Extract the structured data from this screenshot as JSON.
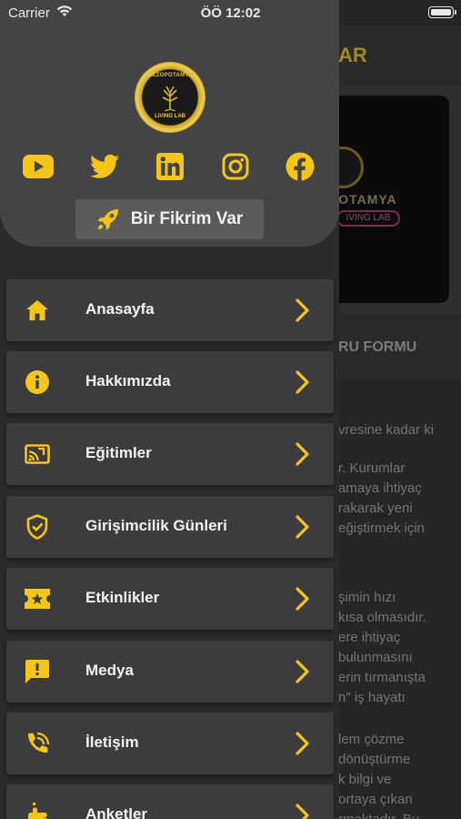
{
  "status_bar": {
    "carrier": "Carrier",
    "time": "ÖÖ 12:02"
  },
  "background_page": {
    "title_fragment": "AR",
    "banner_text": "OPOTAMYA",
    "banner_sub": "IVING LAB",
    "section_fragment": "RU FORMU",
    "paragraph1": [
      "vresine kadar ki"
    ],
    "paragraph2": [
      "r. Kurumlar",
      "amaya ihtiyaç",
      "rakarak yeni",
      "eğiştirmek için"
    ],
    "paragraph3": [
      "şimin hızı",
      "kısa olmasıdır.",
      "ere ihtiyaç",
      "bulunmasını",
      "erin tırmanışta",
      "n\" iş hayatı"
    ],
    "paragraph4": [
      "lem çözme",
      "dönüştürme",
      "k bilgi ve",
      "ortaya çıkan",
      "rmaktadır. Bu"
    ]
  },
  "drawer": {
    "logo": {
      "top_text": "MEZOPOTAMYA",
      "bottom_text": "LIVING LAB"
    },
    "socials": [
      {
        "name": "youtube",
        "icon": "youtube-icon"
      },
      {
        "name": "twitter",
        "icon": "twitter-icon"
      },
      {
        "name": "linkedin",
        "icon": "linkedin-icon"
      },
      {
        "name": "instagram",
        "icon": "instagram-icon"
      },
      {
        "name": "facebook",
        "icon": "facebook-icon"
      }
    ],
    "idea_button_label": "Bir Fikrim Var",
    "menu": [
      {
        "label": "Anasayfa",
        "icon": "home-icon"
      },
      {
        "label": "Hakkımızda",
        "icon": "info-icon"
      },
      {
        "label": "Eğitimler",
        "icon": "cast-education-icon"
      },
      {
        "label": "Girişimcilik Günleri",
        "icon": "shield-check-icon"
      },
      {
        "label": "Etkinlikler",
        "icon": "ticket-star-icon"
      },
      {
        "label": "Medya",
        "icon": "feedback-icon"
      },
      {
        "label": "İletişim",
        "icon": "contact-icon"
      },
      {
        "label": "Anketler",
        "icon": "hand-icon"
      }
    ]
  },
  "colors": {
    "accent": "#f5c518",
    "drawer_bg": "#2b2b2b",
    "header_bg": "#444444",
    "menu_item_bg": "#3c3c3c"
  }
}
